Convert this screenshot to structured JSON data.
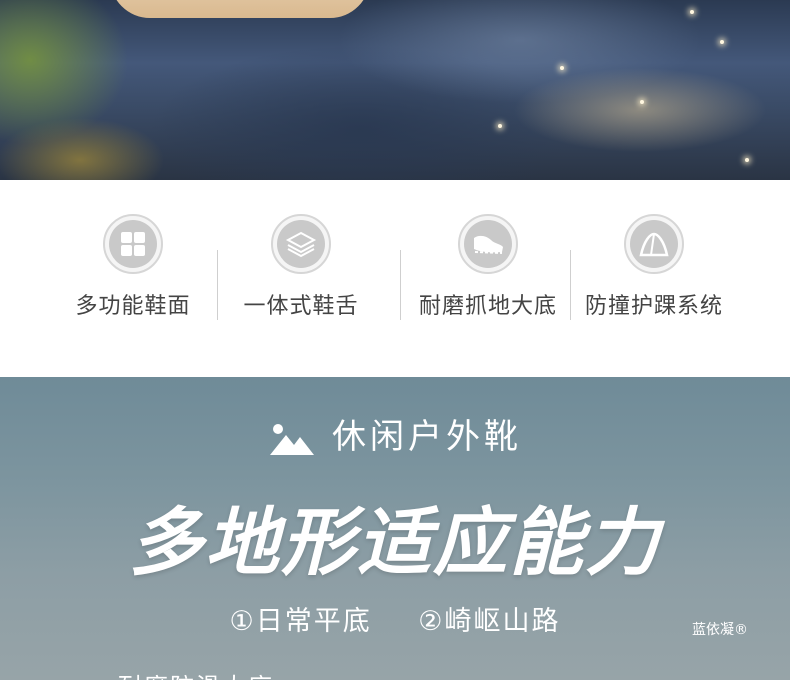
{
  "features": [
    {
      "icon": "grid-squares-icon",
      "label": "多功能鞋面"
    },
    {
      "icon": "layers-icon",
      "label": "一体式鞋舌"
    },
    {
      "icon": "shoe-sole-icon",
      "label": "耐磨抓地大底"
    },
    {
      "icon": "tent-icon",
      "label": "防撞护踝系统"
    }
  ],
  "banner": {
    "subtitle": "休闲户外靴",
    "subtitle_icon": "mountain-icon",
    "headline": "多地形适应能力",
    "tags": [
      "①日常平底",
      "②崎岖山路"
    ],
    "brand": "蓝依凝®",
    "partial_text": "耐磨防滑大底"
  },
  "colors": {
    "feature_text": "#444444",
    "icon_gray": "#c9c9c9",
    "banner_bg": "#7d959f"
  }
}
